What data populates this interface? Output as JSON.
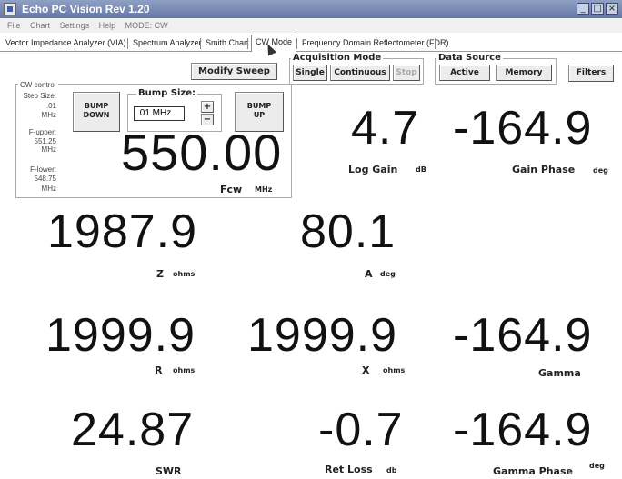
{
  "window": {
    "title": "Echo PC Vision Rev 1.20",
    "minimize": "_",
    "maximize": "□",
    "close": "×"
  },
  "menu": [
    "File",
    "Chart",
    "Settings",
    "Help",
    "MODE: CW"
  ],
  "tabs": [
    "Vector Impedance Analyzer (VIA)",
    "Spectrum Analyzer",
    "Smith Chart",
    "CW Mode",
    "Frequency Domain Reflectometer (FDR)"
  ],
  "active_tab": "CW Mode",
  "toolbar": {
    "modify_sweep": "Modify Sweep",
    "acquisition_mode_label": "Acquisition Mode",
    "single": "Single",
    "continuous": "Continuous",
    "stop": "Stop",
    "data_source_label": "Data Source",
    "active": "Active",
    "memory": "Memory",
    "filters": "Filters"
  },
  "cw_control": {
    "label": "CW control",
    "step_size_label": "Step Size:",
    "step_size_value": ".01",
    "step_size_unit": "MHz",
    "fupper_label": "F-upper:",
    "fupper_value": "551.25",
    "fupper_unit": "MHz",
    "flower_label": "F-lower:",
    "flower_value": "548.75",
    "flower_unit": "MHz",
    "bump_down": "BUMP\nDOWN",
    "bump_up": "BUMP\nUP",
    "bump_size_label": "Bump Size:",
    "bump_size_value": ".01 MHz",
    "plus": "+",
    "minus": "−",
    "fcw_value": "550.00",
    "fcw_label": "Fcw",
    "fcw_unit": "MHz"
  },
  "readouts": {
    "log_gain": {
      "value": "4.7",
      "label": "Log Gain",
      "unit": "dB"
    },
    "gain_phase": {
      "value": "-164.9",
      "label": "Gain Phase",
      "unit": "deg"
    },
    "z": {
      "value": "1987.9",
      "label": "Z",
      "unit": "ohms"
    },
    "a": {
      "value": "80.1",
      "label": "A",
      "unit": "deg"
    },
    "r": {
      "value": "1999.9",
      "label": "R",
      "unit": "ohms"
    },
    "x": {
      "value": "1999.9",
      "label": "X",
      "unit": "ohms"
    },
    "gamma": {
      "value": "-164.9",
      "label": "Gamma",
      "unit": ""
    },
    "swr": {
      "value": "24.87",
      "label": "SWR",
      "unit": ""
    },
    "ret_loss": {
      "value": "-0.7",
      "label": "Ret Loss",
      "unit": "db"
    },
    "gamma_phase": {
      "value": "-164.9",
      "label": "Gamma Phase",
      "unit": "deg"
    }
  }
}
